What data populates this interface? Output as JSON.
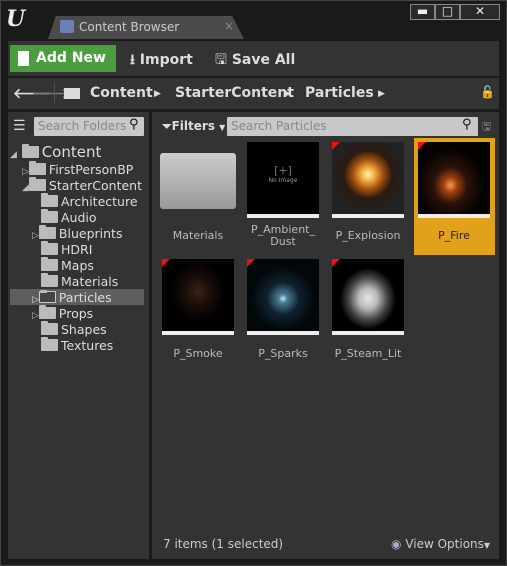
{
  "window": {
    "tab_title": "Content Browser",
    "tab_close": "×",
    "minimize": "▬",
    "maximize": "□",
    "close": "✕",
    "logo": "U"
  },
  "toolbar": {
    "add_new": "Add New",
    "import": "Import",
    "save_all": "Save All"
  },
  "path": {
    "crumbs": [
      "Content",
      "StarterContent",
      "Particles"
    ]
  },
  "sources": {
    "search_placeholder": "Search Folders",
    "tree": [
      {
        "label": "Content"
      },
      {
        "label": "FirstPersonBP"
      },
      {
        "label": "StarterContent"
      },
      {
        "label": "Architecture"
      },
      {
        "label": "Audio"
      },
      {
        "label": "Blueprints"
      },
      {
        "label": "HDRI"
      },
      {
        "label": "Maps"
      },
      {
        "label": "Materials"
      },
      {
        "label": "Particles"
      },
      {
        "label": "Props"
      },
      {
        "label": "Shapes"
      },
      {
        "label": "Textures"
      }
    ]
  },
  "assets": {
    "filters": "Filters",
    "search_placeholder": "Search Particles",
    "items": [
      {
        "label": "Materials"
      },
      {
        "label": "P_Ambient_ Dust",
        "thumb_text": "No Image"
      },
      {
        "label": "P_Explosion"
      },
      {
        "label": "P_Fire"
      },
      {
        "label": "P_Smoke"
      },
      {
        "label": "P_Sparks"
      },
      {
        "label": "P_Steam_Lit"
      }
    ],
    "status": "7 items (1 selected)",
    "view_options": "View Options"
  },
  "colors": {
    "accent": "#e2a11b",
    "add_new": "#4a9e3e"
  }
}
